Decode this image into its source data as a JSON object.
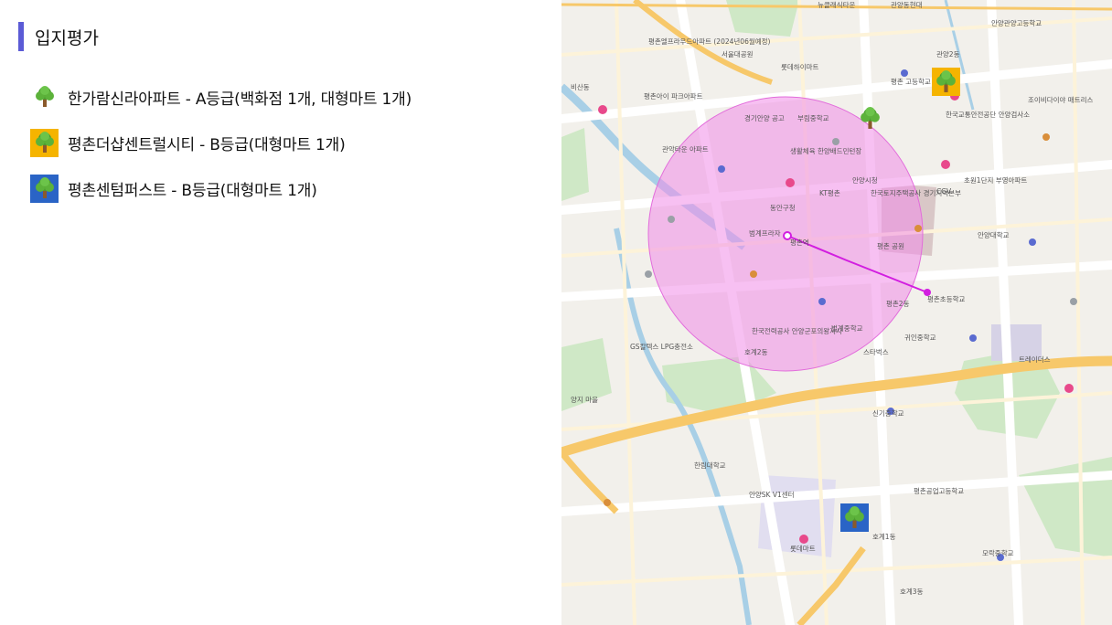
{
  "header": {
    "title": "입지평가",
    "accent_color": "#5b5bd6"
  },
  "legend": [
    {
      "label": "한가람신라아파트 - A등급(백화점 1개, 대형마트 1개)",
      "grade": "A",
      "marker_style": "plain",
      "icon": "tree-icon"
    },
    {
      "label": "평촌더샵센트럴시티 - B등급(대형마트 1개)",
      "grade": "B",
      "marker_style": "yellow",
      "marker_color": "#f5b400",
      "icon": "tree-icon"
    },
    {
      "label": "평촌센텀퍼스트 - B등급(대형마트 1개)",
      "grade": "B",
      "marker_style": "blue",
      "marker_color": "#2a64c6",
      "icon": "tree-icon"
    }
  ],
  "map": {
    "colors": {
      "base": "#f2f0eb",
      "park": "#cfe8c6",
      "water": "#a8cfe6",
      "major_road": "#ffffff",
      "highway": "#f7c86a",
      "radius_fill": "#f08ce8",
      "route": "#d21ee0"
    },
    "labels": [
      "뉴클래식타운",
      "관양동현대",
      "안양관양고등학교",
      "평촌엘프라우드아파트 (2024년06월예정)",
      "롯데하이마트",
      "서울대공원",
      "비산동",
      "평촌아이 파크아파트",
      "경기안양 공고",
      "부림중학교",
      "생활체육 한양배드민턴장",
      "평촌 고등학교",
      "한국교통안전공단 안양검사소",
      "관악타운 아파트",
      "안양시청",
      "KT평촌",
      "동안구청",
      "범계프라자",
      "평촌역",
      "평촌 공원",
      "초원1단지 부영아파트",
      "한국토지주택공사 경기지역본부",
      "평촌2동",
      "한국전력공사 안양군포의왕지사",
      "호계2동",
      "귀인중학교",
      "벌계중학교",
      "신기중학교",
      "안양대학교",
      "스타벅스",
      "CGV",
      "롯데마트",
      "트레이더스",
      "GS칼텍스 LPG충전소",
      "한림대학교",
      "안양SK V1센터",
      "호계1동",
      "모락중학교",
      "평촌공업고등학교",
      "평촌초등학교",
      "호계3동",
      "양지 마을",
      "관양2동",
      "조이비다이야 매트리스"
    ]
  }
}
